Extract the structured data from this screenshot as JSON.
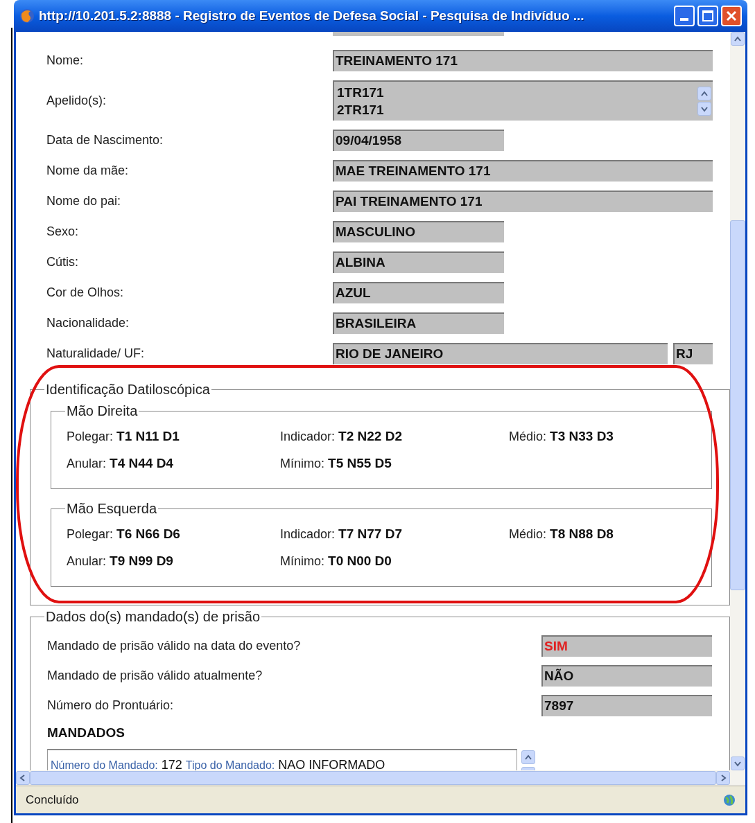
{
  "window": {
    "title": "http://10.201.5.2:8888 - Registro de Eventos de Defesa Social - Pesquisa de Indivíduo ..."
  },
  "personal_fields": [
    {
      "label": "Nome:",
      "kind": "wide",
      "value": "TREINAMENTO 171"
    },
    {
      "label": "Apelido(s):",
      "kind": "multiline",
      "lines": [
        "1TR171",
        "2TR171"
      ]
    },
    {
      "label": "Data de Nascimento:",
      "kind": "short",
      "value": "09/04/1958"
    },
    {
      "label": "Nome da mãe:",
      "kind": "wide",
      "value": "MAE TREINAMENTO 171"
    },
    {
      "label": "Nome do pai:",
      "kind": "wide",
      "value": "PAI TREINAMENTO 171"
    },
    {
      "label": "Sexo:",
      "kind": "short",
      "value": "MASCULINO"
    },
    {
      "label": "Cútis:",
      "kind": "short",
      "value": "ALBINA"
    },
    {
      "label": "Cor de Olhos:",
      "kind": "short",
      "value": "AZUL"
    },
    {
      "label": "Nacionalidade:",
      "kind": "short",
      "value": "BRASILEIRA"
    },
    {
      "label": "Naturalidade/ UF:",
      "kind": "place",
      "value": "RIO DE JANEIRO",
      "uf": "RJ"
    }
  ],
  "fingerprint_section": {
    "title": "Identificação Datiloscópica",
    "hands": [
      {
        "title": "Mão Direita",
        "fingers": [
          {
            "label": "Polegar:",
            "value": "T1 N11 D1"
          },
          {
            "label": "Indicador:",
            "value": "T2 N22 D2"
          },
          {
            "label": "Médio:",
            "value": "T3 N33 D3"
          },
          {
            "label": "Anular:",
            "value": "T4 N44 D4"
          },
          {
            "label": "Mínimo:",
            "value": "T5 N55 D5"
          }
        ]
      },
      {
        "title": "Mão Esquerda",
        "fingers": [
          {
            "label": "Polegar:",
            "value": "T6 N66 D6"
          },
          {
            "label": "Indicador:",
            "value": "T7 N77 D7"
          },
          {
            "label": "Médio:",
            "value": "T8 N88 D8"
          },
          {
            "label": "Anular:",
            "value": "T9 N99 D9"
          },
          {
            "label": "Mínimo:",
            "value": "T0 N00 D0"
          }
        ]
      }
    ]
  },
  "warrant_section": {
    "title": "Dados do(s) mandado(s) de prisão",
    "fields": [
      {
        "label": "Mandado de prisão válido na data do evento?",
        "value": "SIM",
        "alert": true
      },
      {
        "label": "Mandado de prisão válido atualmente?",
        "value": "NÃO",
        "alert": false
      },
      {
        "label": "Número do Prontuário:",
        "value": "7897",
        "alert": false
      }
    ],
    "list_title": "MANDADOS",
    "list_items": [
      {
        "number_label": "Número do Mandado:",
        "number": "172",
        "type_label": "Tipo do Mandado:",
        "type": "NAO INFORMADO"
      }
    ]
  },
  "status_bar": {
    "text": "Concluído"
  }
}
